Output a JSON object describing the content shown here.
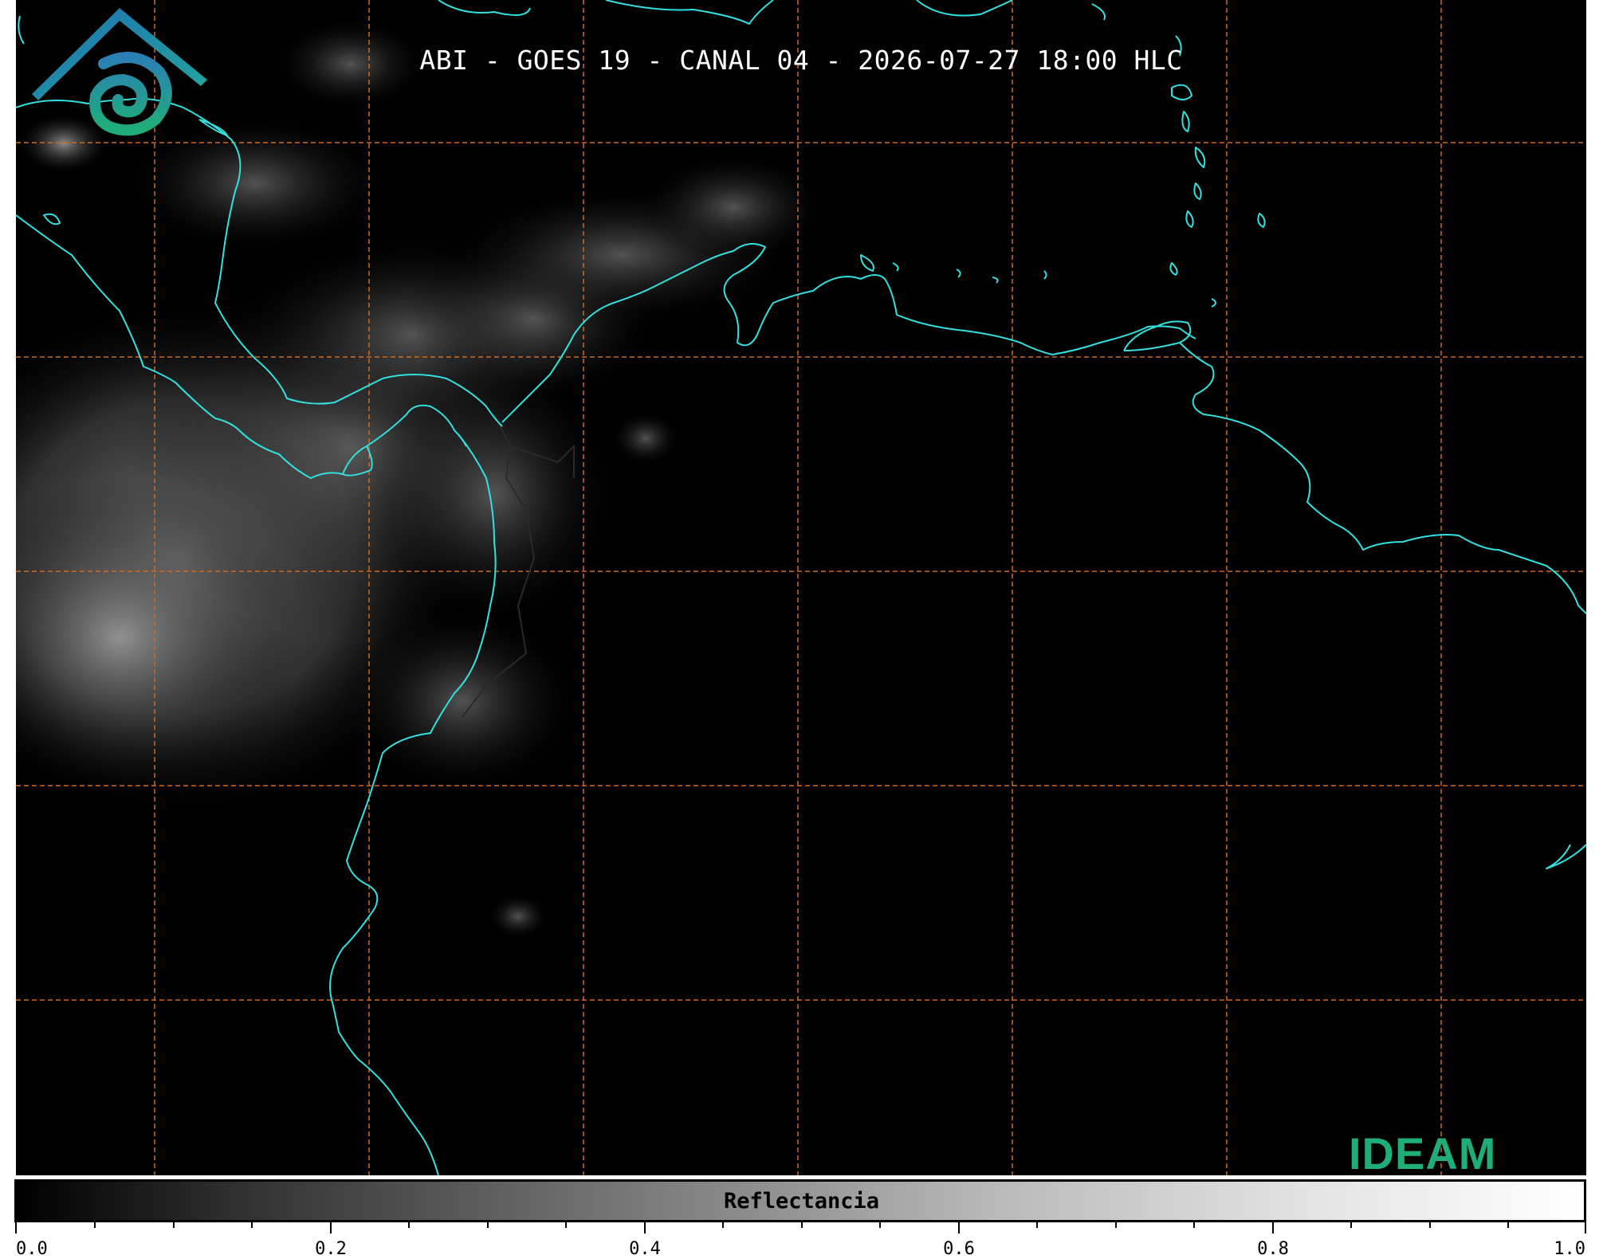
{
  "title": "ABI - GOES 19 - CANAL 04 - 2026-07-27 18:00 HLC",
  "logo": {
    "text": "IDEAM"
  },
  "colorbar": {
    "label": "Reflectancia",
    "ticks": [
      "0.0",
      "0.2",
      "0.4",
      "0.6",
      "0.8",
      "1.0"
    ],
    "range": [
      0.0,
      1.0
    ],
    "colormap": "grayscale black-to-white"
  },
  "colors": {
    "background": "#000000",
    "coastline": "#33e0e0",
    "gridlines": "#d2691e",
    "logo_text": "#1fae78",
    "logo_roof": "#1f6fb0"
  },
  "map": {
    "gridlines": "dashed orange",
    "coastlines": "cyan",
    "borders": "dark gray"
  }
}
